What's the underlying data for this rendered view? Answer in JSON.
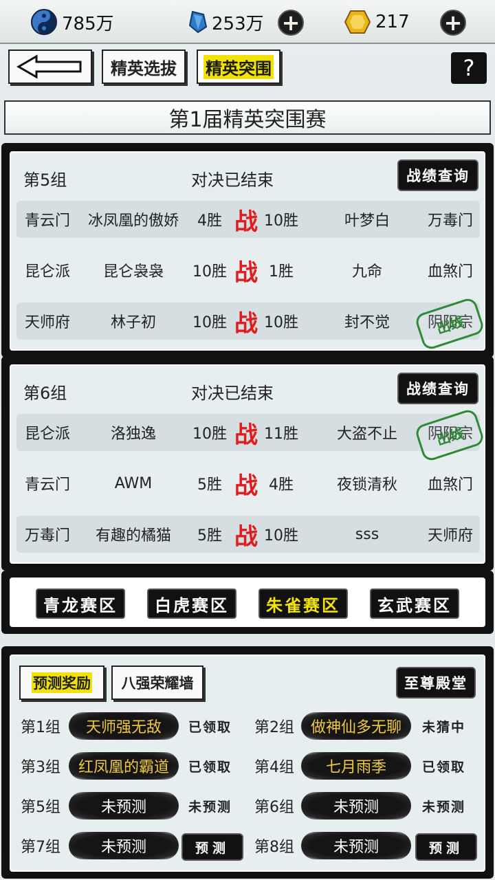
{
  "resources": {
    "silver": "785万",
    "gems": "253万",
    "gold": "217"
  },
  "nav": {
    "tab1": "精英选拔",
    "tab2": "精英突围",
    "help": "?"
  },
  "title": "第1届精英突围赛",
  "groups": [
    {
      "name": "第5组",
      "status": "对决已结束",
      "record_btn": "战绩查询",
      "matches": [
        {
          "left_sect": "青云门",
          "left_player": "冰凤凰的傲娇",
          "left_wins": "4胜",
          "vs": "战",
          "right_wins": "10胜",
          "right_player": "叶梦白",
          "right_sect": "万毒门",
          "stamp": ""
        },
        {
          "left_sect": "昆仑派",
          "left_player": "昆仑袅袅",
          "left_wins": "10胜",
          "vs": "战",
          "right_wins": "1胜",
          "right_player": "九命",
          "right_sect": "血煞门",
          "stamp": ""
        },
        {
          "left_sect": "天师府",
          "left_player": "林子初",
          "left_wins": "10胜",
          "vs": "战",
          "right_wins": "10胜",
          "right_player": "封不觉",
          "right_sect": "阴阳宗",
          "stamp": "出线"
        }
      ]
    },
    {
      "name": "第6组",
      "status": "对决已结束",
      "record_btn": "战绩查询",
      "matches": [
        {
          "left_sect": "昆仑派",
          "left_player": "洛独逸",
          "left_wins": "10胜",
          "vs": "战",
          "right_wins": "11胜",
          "right_player": "大盗不止",
          "right_sect": "阴阳宗",
          "stamp": "出线"
        },
        {
          "left_sect": "青云门",
          "left_player": "AWM",
          "left_wins": "5胜",
          "vs": "战",
          "right_wins": "4胜",
          "right_player": "夜锁清秋",
          "right_sect": "血煞门",
          "stamp": ""
        },
        {
          "left_sect": "万毒门",
          "left_player": "有趣的橘猫",
          "left_wins": "5胜",
          "vs": "战",
          "right_wins": "10胜",
          "right_player": "sss",
          "right_sect": "天师府",
          "stamp": ""
        }
      ]
    }
  ],
  "zones": [
    "青龙赛区",
    "白虎赛区",
    "朱雀赛区",
    "玄武赛区"
  ],
  "prediction": {
    "tab1": "预测奖励",
    "tab2": "八强荣耀墙",
    "hall_btn": "至尊殿堂",
    "items": [
      {
        "group": "第1组",
        "pick": "天师强无敌",
        "status": "已领取",
        "highlight": true
      },
      {
        "group": "第2组",
        "pick": "做神仙多无聊",
        "status": "未猜中",
        "highlight": true
      },
      {
        "group": "第3组",
        "pick": "红凤凰的霸道",
        "status": "已领取",
        "highlight": true
      },
      {
        "group": "第4组",
        "pick": "七月雨季",
        "status": "已领取",
        "highlight": true
      },
      {
        "group": "第5组",
        "pick": "未预测",
        "status": "未预测",
        "highlight": false
      },
      {
        "group": "第6组",
        "pick": "未预测",
        "status": "未预测",
        "highlight": false
      },
      {
        "group": "第7组",
        "pick": "未预测",
        "status": "预测",
        "highlight": false
      },
      {
        "group": "第8组",
        "pick": "未预测",
        "status": "预测",
        "highlight": false
      }
    ]
  }
}
